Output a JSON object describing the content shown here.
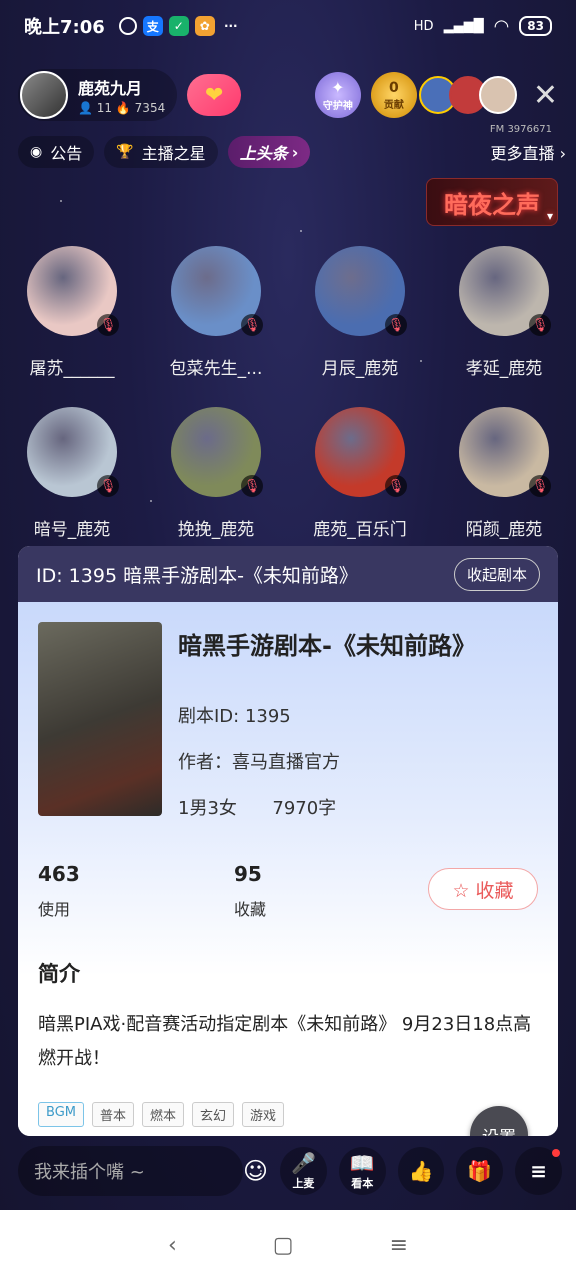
{
  "status_bar": {
    "time": "晚上7:06",
    "hd": "HD",
    "battery": "83"
  },
  "host": {
    "name": "鹿苑九月",
    "followers": "11",
    "heat": "7354",
    "fm_id": "FM 3976671"
  },
  "badges": {
    "guard_label": "守护神",
    "contrib_label": "贡献",
    "contrib_count": "0"
  },
  "tags_row": {
    "notice": "公告",
    "star": "主播之星",
    "headline": "上头条",
    "more_live": "更多直播"
  },
  "room_logo": "暗夜之声",
  "seats": [
    {
      "name": "屠苏______",
      "color": "#e9c8c4"
    },
    {
      "name": "包菜先生_...",
      "color": "#6a8fc8"
    },
    {
      "name": "月辰_鹿苑",
      "color": "#4b6db0"
    },
    {
      "name": "孝延_鹿苑",
      "color": "#bdb6ad"
    },
    {
      "name": "暗号_鹿苑",
      "color": "#b9c6d3"
    },
    {
      "name": "挽挽_鹿苑",
      "color": "#7f8a5a"
    },
    {
      "name": "鹿苑_百乐门",
      "color": "#c43a2a"
    },
    {
      "name": "陌颜_鹿苑",
      "color": "#c9b9a2"
    }
  ],
  "script_card": {
    "header_title": "ID: 1395 暗黑手游剧本-《未知前路》",
    "collapse_label": "收起剧本",
    "title": "暗黑手游剧本-《未知前路》",
    "script_id": "剧本ID: 1395",
    "author": "作者：喜马直播官方",
    "roles": "1男3女",
    "words": "7970字",
    "uses_count": "463",
    "uses_label": "使用",
    "favs_count": "95",
    "favs_label": "收藏",
    "fav_button": "☆ 收藏",
    "intro_heading": "简介",
    "intro_text": "暗黑PIA戏·配音赛活动指定剧本《未知前路》 9月23日18点高燃开战！",
    "tags": [
      "BGM",
      "普本",
      "燃本",
      "玄幻",
      "游戏"
    ],
    "settings_label": "设置"
  },
  "toolbar": {
    "chat_placeholder": "我来插个嘴 ~",
    "mic_label": "上麦",
    "book_label": "看本"
  }
}
